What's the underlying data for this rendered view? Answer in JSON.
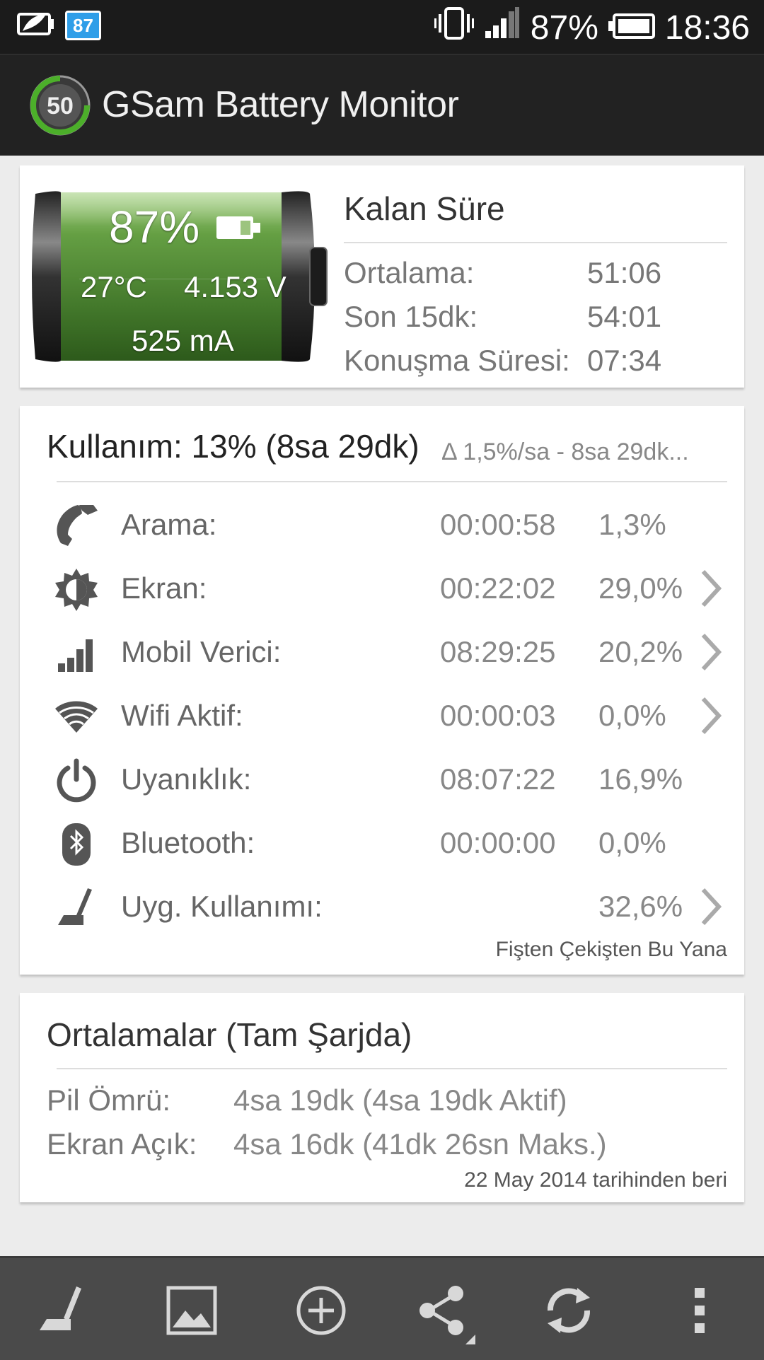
{
  "status_bar": {
    "notification_badge": "87",
    "battery_percent": "87%",
    "time": "18:36"
  },
  "app_bar": {
    "logo_number": "50",
    "title": "GSam Battery Monitor"
  },
  "battery_card": {
    "level": "87%",
    "temperature": "27°C",
    "voltage": "4.153 V",
    "current": "525 mA",
    "remaining_title": "Kalan Süre",
    "rows": [
      {
        "label": "Ortalama:",
        "value": "51:06"
      },
      {
        "label": "Son 15dk:",
        "value": "54:01"
      },
      {
        "label": "Konuşma Süresi:",
        "value": "07:34"
      }
    ]
  },
  "usage_card": {
    "title": "Kullanım: 13% (8sa 29dk)",
    "subtitle": "Δ 1,5%/sa - 8sa 29dk...",
    "rows": [
      {
        "icon": "phone-icon",
        "label": "Arama:",
        "time": "00:00:58",
        "percent": "1,3%",
        "has_chevron": false
      },
      {
        "icon": "brightness-icon",
        "label": "Ekran:",
        "time": "00:22:02",
        "percent": "29,0%",
        "has_chevron": true
      },
      {
        "icon": "signal-bars-icon",
        "label": "Mobil Verici:",
        "time": "08:29:25",
        "percent": "20,2%",
        "has_chevron": true
      },
      {
        "icon": "wifi-icon",
        "label": "Wifi Aktif:",
        "time": "00:00:03",
        "percent": "0,0%",
        "has_chevron": true
      },
      {
        "icon": "power-icon",
        "label": "Uyanıklık:",
        "time": "08:07:22",
        "percent": "16,9%",
        "has_chevron": false
      },
      {
        "icon": "bluetooth-icon",
        "label": "Bluetooth:",
        "time": "00:00:00",
        "percent": "0,0%",
        "has_chevron": false
      },
      {
        "icon": "app-usage-icon",
        "label": "Uyg. Kullanımı:",
        "time": "",
        "percent": "32,6%",
        "has_chevron": true
      }
    ],
    "footer": "Fişten Çekişten Bu Yana"
  },
  "averages_card": {
    "title": "Ortalamalar (Tam Şarjda)",
    "rows": [
      {
        "label": "Pil Ömrü:",
        "value": "4sa 19dk (4sa 19dk Aktif)"
      },
      {
        "label": "Ekran Açık:",
        "value": "4sa 16dk (41dk 26sn Maks.)"
      }
    ],
    "footer": "22 May 2014 tarihinden beri"
  },
  "bottom_bar": {
    "buttons": [
      "app-usage-icon",
      "image-icon",
      "add-circle-icon",
      "share-icon",
      "refresh-icon",
      "overflow-menu-icon"
    ]
  },
  "colors": {
    "status_bar_bg": "#1b1b1b",
    "app_bar_bg": "#222222",
    "page_bg": "#ececec",
    "battery_green": "#5a8f3a",
    "logo_ring": "#4caf2a",
    "bottom_bar_bg": "#4a4a4a"
  }
}
